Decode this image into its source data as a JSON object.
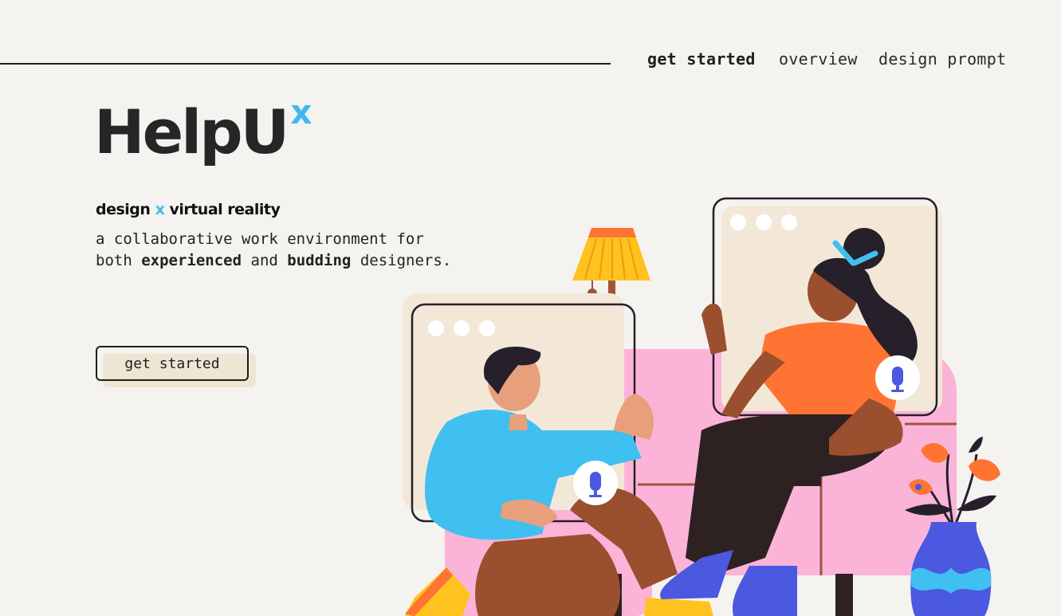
{
  "nav": {
    "items": [
      {
        "label": "get started",
        "active": true
      },
      {
        "label": "overview",
        "active": false
      },
      {
        "label": "design prompt",
        "active": false
      }
    ]
  },
  "hero": {
    "logo_text": "HelpU",
    "logo_super": "x",
    "tagline_a": "design",
    "tagline_x": "x",
    "tagline_b": "virtual reality",
    "desc_line1": "a collaborative work environment for",
    "desc_both": "both",
    "desc_experienced": "experienced",
    "desc_and": "and",
    "desc_budding": "budding",
    "desc_end": "designers.",
    "cta_label": "get started"
  },
  "colors": {
    "accent": "#3fb8f0",
    "background": "#f4f3f0",
    "text": "#1e1e1e",
    "cta_shadow": "#efe5d3",
    "sofa": "#fbb4d8",
    "orange": "#ff7433",
    "blue_shirt": "#40c0f0",
    "skin_dark": "#9a4f2f",
    "mic": "#4a59e0"
  },
  "illustration": {
    "icons": [
      "microphone-icon",
      "microphone-icon"
    ]
  }
}
